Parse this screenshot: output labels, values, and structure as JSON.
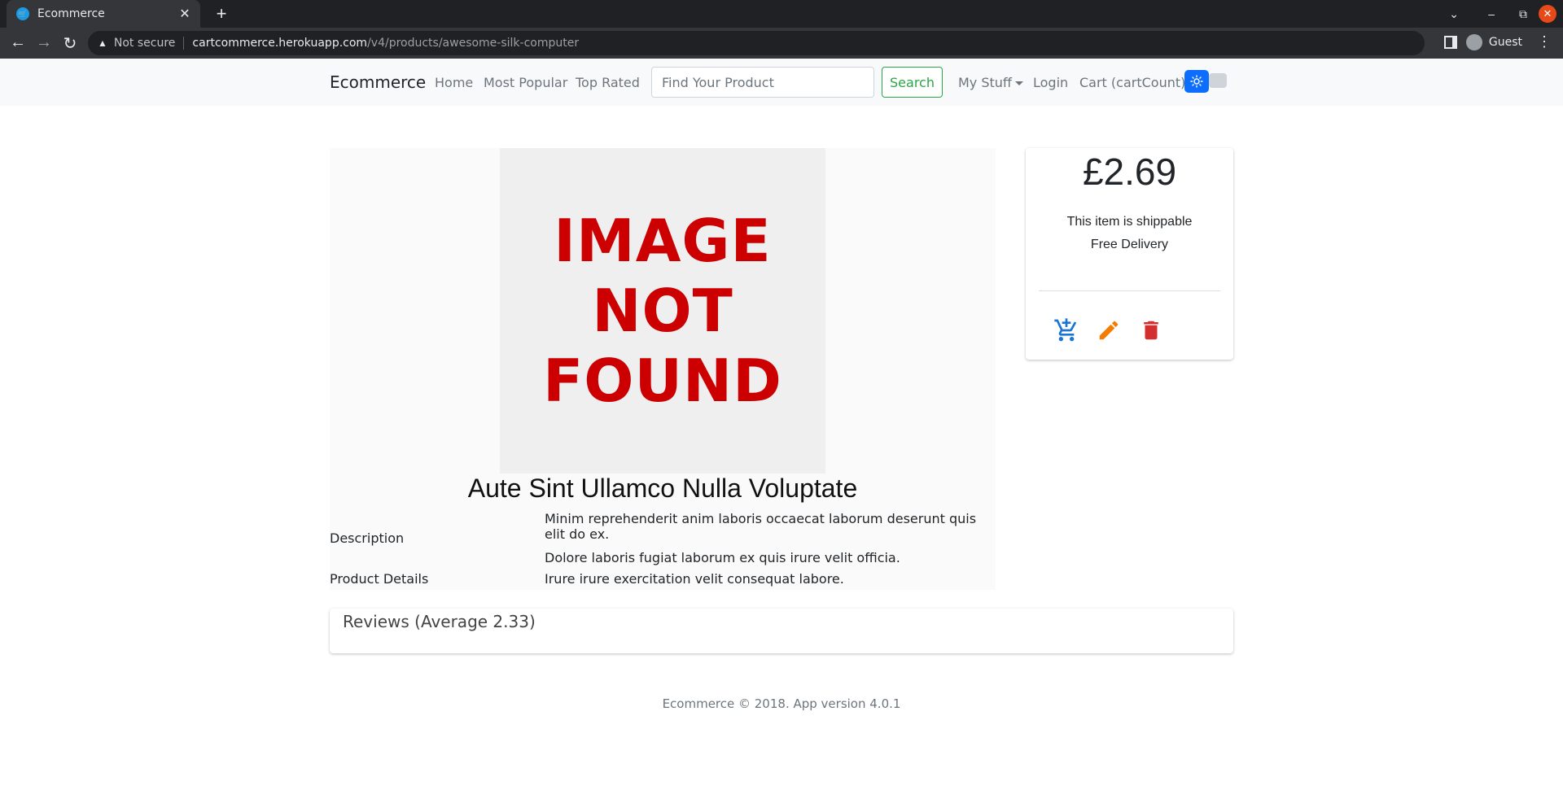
{
  "browser": {
    "tab_title": "Ecommerce",
    "not_secure": "Not secure",
    "url_host": "cartcommerce.herokuapp.com",
    "url_path": "/v4/products/awesome-silk-computer",
    "profile_name": "Guest"
  },
  "nav": {
    "brand": "Ecommerce",
    "home": "Home",
    "most_popular": "Most Popular",
    "top_rated": "Top Rated",
    "search_placeholder": "Find Your Product",
    "search_button": "Search",
    "my_stuff": "My Stuff",
    "login": "Login",
    "cart": "Cart (cartCount)"
  },
  "product": {
    "image_text": [
      "IMAGE",
      "NOT",
      "FOUND"
    ],
    "title": "Aute Sint Ullamco Nulla Voluptate",
    "description_label": "Description",
    "description_lines": [
      "Minim reprehenderit anim laboris occaecat laborum deserunt quis elit do ex.",
      "Dolore laboris fugiat laborum ex quis irure velit officia."
    ],
    "details_label": "Product Details",
    "details_value": "Irure irure exercitation velit consequat labore."
  },
  "price_card": {
    "price": "£2.69",
    "shippable": "This item is shippable",
    "delivery": "Free Delivery"
  },
  "reviews": {
    "title": "Reviews (Average 2.33)"
  },
  "footer": {
    "text": "Ecommerce © 2018. App version 4.0.1"
  },
  "colors": {
    "accent_blue": "#1976d2",
    "edit_orange": "#f57c00",
    "delete_red": "#d32f2f",
    "search_green": "#28a745"
  }
}
